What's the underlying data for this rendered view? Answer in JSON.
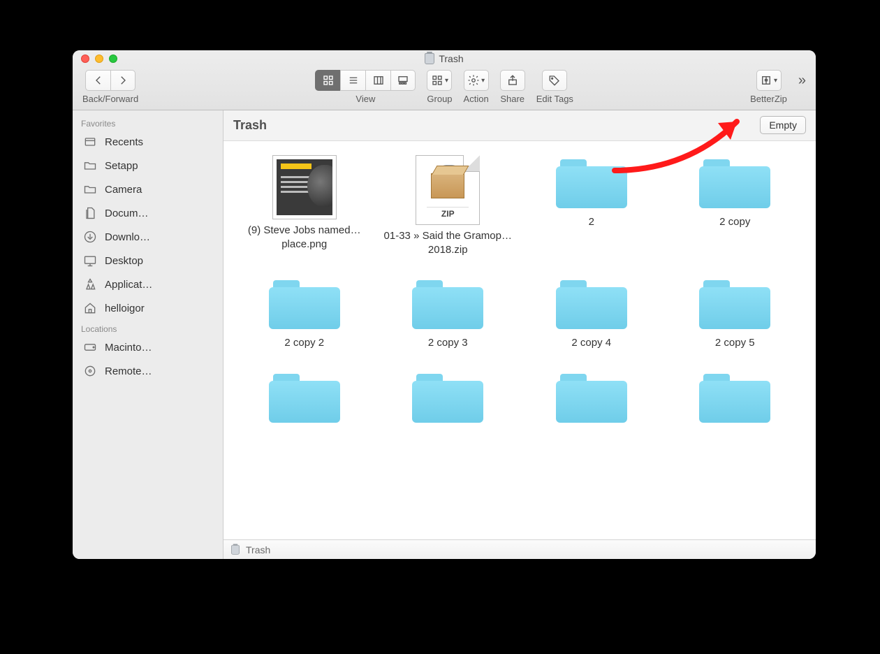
{
  "window": {
    "title": "Trash"
  },
  "toolbar": {
    "back_forward_label": "Back/Forward",
    "view_label": "View",
    "group_label": "Group",
    "action_label": "Action",
    "share_label": "Share",
    "edit_tags_label": "Edit Tags",
    "betterzip_label": "BetterZip"
  },
  "sidebar": {
    "sections": [
      {
        "header": "Favorites",
        "items": [
          {
            "icon": "recents-icon",
            "label": "Recents"
          },
          {
            "icon": "folder-icon",
            "label": "Setapp"
          },
          {
            "icon": "folder-icon",
            "label": "Camera"
          },
          {
            "icon": "documents-icon",
            "label": "Docum…"
          },
          {
            "icon": "downloads-icon",
            "label": "Downlo…"
          },
          {
            "icon": "desktop-icon",
            "label": "Desktop"
          },
          {
            "icon": "applications-icon",
            "label": "Applicat…"
          },
          {
            "icon": "home-icon",
            "label": "helloigor"
          }
        ]
      },
      {
        "header": "Locations",
        "items": [
          {
            "icon": "hdd-icon",
            "label": "Macinto…"
          },
          {
            "icon": "remote-disc-icon",
            "label": "Remote…"
          }
        ]
      }
    ]
  },
  "location": {
    "title": "Trash",
    "empty_label": "Empty"
  },
  "items": [
    {
      "kind": "image",
      "label": "(9) Steve Jobs named…place.png"
    },
    {
      "kind": "zip",
      "label": "01-33 » Said the Gramop…2018.zip",
      "zip_badge": "ZIP"
    },
    {
      "kind": "folder",
      "label": "2"
    },
    {
      "kind": "folder",
      "label": "2 copy"
    },
    {
      "kind": "folder",
      "label": "2 copy 2"
    },
    {
      "kind": "folder",
      "label": "2 copy 3"
    },
    {
      "kind": "folder",
      "label": "2 copy 4"
    },
    {
      "kind": "folder",
      "label": "2 copy 5"
    },
    {
      "kind": "folder",
      "label": ""
    },
    {
      "kind": "folder",
      "label": ""
    },
    {
      "kind": "folder",
      "label": ""
    },
    {
      "kind": "folder",
      "label": ""
    }
  ],
  "pathbar": {
    "label": "Trash"
  }
}
